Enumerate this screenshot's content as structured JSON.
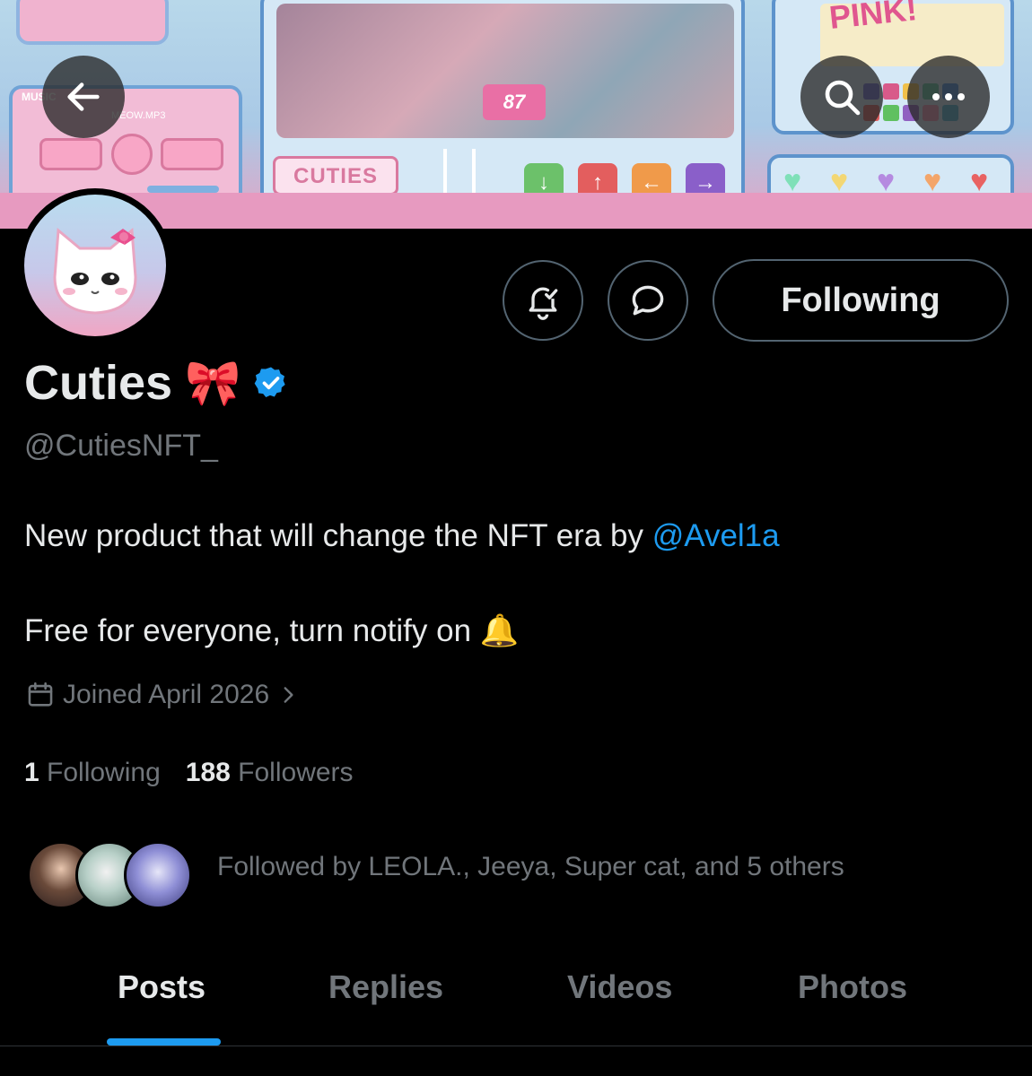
{
  "banner": {
    "music_label": "MUSIC",
    "track": "MEOW.MP3",
    "tag": "CUTIES",
    "jersey_number": "87",
    "word": "PINK!"
  },
  "nav": {
    "back_icon": "arrow-left-icon",
    "search_icon": "search-icon",
    "more_icon": "more-dots-icon"
  },
  "actions": {
    "notify_icon": "bell-check-icon",
    "message_icon": "message-bubble-icon",
    "follow_label": "Following"
  },
  "profile": {
    "name": "Cuties",
    "name_emoji": "🎀",
    "verified": true,
    "handle": "@CutiesNFT_",
    "bio_line1": "New product that will change the NFT era by ",
    "bio_mention": "@Avel1a",
    "bio_line2": "Free for everyone, turn notify on",
    "bio_emoji": "🔔",
    "joined": "Joined April 2026",
    "following_count": "1",
    "following_label": "Following",
    "followers_count": "188",
    "followers_label": "Followers",
    "followed_by": "Followed by LEOLA., Jeeya, Super cat, and 5 others"
  },
  "tabs": [
    {
      "label": "Posts",
      "active": true
    },
    {
      "label": "Replies",
      "active": false
    },
    {
      "label": "Videos",
      "active": false
    },
    {
      "label": "Photos",
      "active": false
    }
  ],
  "colors": {
    "accent": "#1d9bf0",
    "background": "#000000",
    "muted": "#71767b"
  }
}
